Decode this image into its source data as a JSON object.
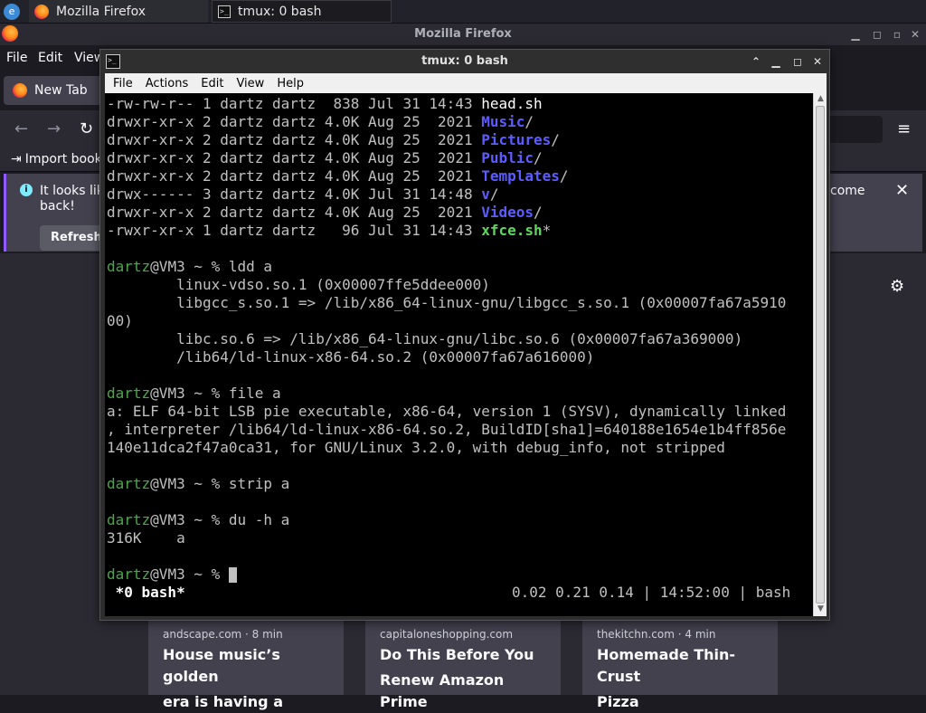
{
  "taskbar": {
    "launcher_glyph": "e",
    "tasks": [
      {
        "label": "Mozilla Firefox",
        "icon": "firefox-icon"
      },
      {
        "label": "tmux: 0 bash",
        "icon": "terminal-icon"
      }
    ]
  },
  "firefox": {
    "title": "Mozilla Firefox",
    "menu": [
      "File",
      "Edit",
      "View"
    ],
    "tab": "New Tab",
    "bookmark": "Import book",
    "notice_line1": "It looks lik",
    "notice_line2": "back!",
    "notice_right": "come",
    "refresh": "Refresh",
    "stories": [
      {
        "source": "andscape.com · 8 min",
        "title1": "House music’s golden",
        "title2": "era is having a"
      },
      {
        "source": "capitaloneshopping.com",
        "title1": "Do This Before You",
        "title2": "Renew Amazon Prime"
      },
      {
        "source": "thekitchn.com · 4 min",
        "title1": "Homemade Thin-Crust",
        "title2": "Pizza"
      }
    ]
  },
  "terminal": {
    "title": "tmux: 0 bash",
    "menu": [
      "File",
      "Actions",
      "Edit",
      "View",
      "Help"
    ],
    "ls": [
      {
        "perm": "-rw-rw-r-- 1 dartz dartz  838 Jul 31 14:43 ",
        "name": "head.sh",
        "suffix": "",
        "kind": "file"
      },
      {
        "perm": "drwxr-xr-x 2 dartz dartz 4.0K Aug 25  2021 ",
        "name": "Music",
        "suffix": "/",
        "kind": "dir"
      },
      {
        "perm": "drwxr-xr-x 2 dartz dartz 4.0K Aug 25  2021 ",
        "name": "Pictures",
        "suffix": "/",
        "kind": "dir"
      },
      {
        "perm": "drwxr-xr-x 2 dartz dartz 4.0K Aug 25  2021 ",
        "name": "Public",
        "suffix": "/",
        "kind": "dir"
      },
      {
        "perm": "drwxr-xr-x 2 dartz dartz 4.0K Aug 25  2021 ",
        "name": "Templates",
        "suffix": "/",
        "kind": "dir"
      },
      {
        "perm": "drwx------ 3 dartz dartz 4.0K Jul 31 14:48 ",
        "name": "v",
        "suffix": "/",
        "kind": "dir"
      },
      {
        "perm": "drwxr-xr-x 2 dartz dartz 4.0K Aug 25  2021 ",
        "name": "Videos",
        "suffix": "/",
        "kind": "dir"
      },
      {
        "perm": "-rwxr-xr-x 1 dartz dartz   96 Jul 31 14:43 ",
        "name": "xfce.sh",
        "suffix": "*",
        "kind": "exe"
      }
    ],
    "prompt_user": "dartz",
    "prompt_rest": "@VM3 ~ % ",
    "cmd_ldd": "ldd a",
    "ldd_out": [
      "        linux-vdso.so.1 (0x00007ffe5ddee000)",
      "        libgcc_s.so.1 => /lib/x86_64-linux-gnu/libgcc_s.so.1 (0x00007fa67a5910",
      "00)",
      "        libc.so.6 => /lib/x86_64-linux-gnu/libc.so.6 (0x00007fa67a369000)",
      "        /lib64/ld-linux-x86-64.so.2 (0x00007fa67a616000)"
    ],
    "cmd_file": "file a",
    "file_out": [
      "a: ELF 64-bit LSB pie executable, x86-64, version 1 (SYSV), dynamically linked",
      ", interpreter /lib64/ld-linux-x86-64.so.2, BuildID[sha1]=640188e1654e1b4ff856e",
      "140e11dca2f47a0ca31, for GNU/Linux 3.2.0, with debug_info, not stripped"
    ],
    "cmd_strip": "strip a",
    "cmd_du": "du -h a",
    "du_out": "316K    a",
    "status_left": " *0 bash*",
    "status_right": "0.02 0.21 0.14 | 14:52:00 | bash"
  }
}
